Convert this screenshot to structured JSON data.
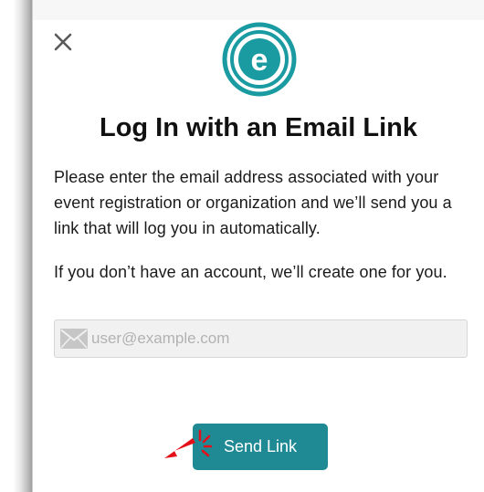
{
  "header": {
    "close_icon": "close-icon",
    "logo_letter": "e",
    "logo_color": "#1a9ba1"
  },
  "title": "Log In with an Email Link",
  "paragraphs": {
    "instructions": "Please enter the email address associated with your event registration or organization and we’ll send you a link that will log you in automatically.",
    "no_account": "If you don’t have an account, we’ll create one for you."
  },
  "email_field": {
    "icon": "envelope-icon",
    "placeholder": "user@example.com",
    "value": ""
  },
  "send_button": {
    "label": "Send Link",
    "color": "#1f8a93"
  },
  "cursor": {
    "icon": "pointer-arrow-icon",
    "color": "#e3101a"
  }
}
